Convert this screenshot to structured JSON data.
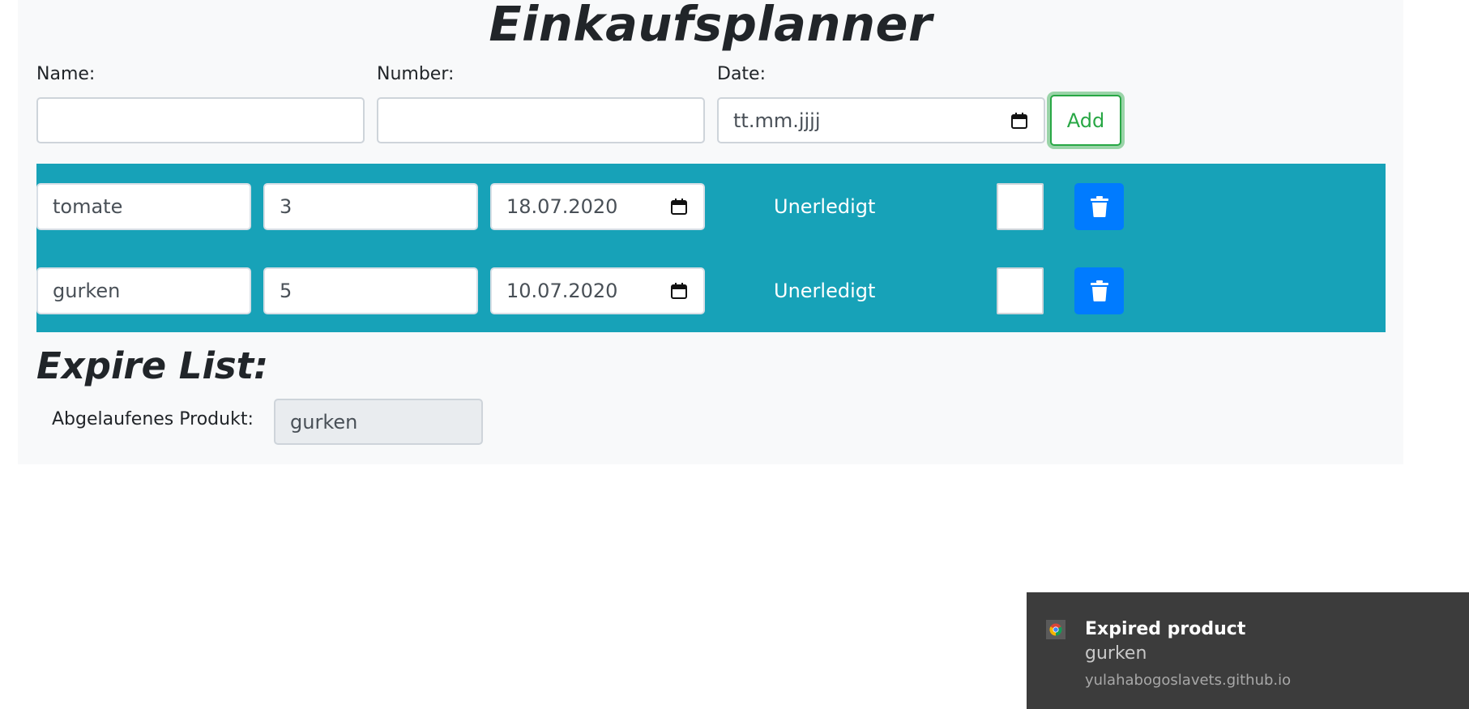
{
  "app": {
    "title": "Einkaufsplanner"
  },
  "form": {
    "name_label": "Name:",
    "number_label": "Number:",
    "date_label": "Date:",
    "name_value": "",
    "number_value": "",
    "date_placeholder": "tt.mm.jjjj",
    "add_label": "Add"
  },
  "items": [
    {
      "name": "tomate",
      "number": "3",
      "date": "18.07.2020",
      "status": "Unerledigt",
      "done": false
    },
    {
      "name": "gurken",
      "number": "5",
      "date": "10.07.2020",
      "status": "Unerledigt",
      "done": false
    }
  ],
  "expire": {
    "title": "Expire List:",
    "label": "Abgelaufenes Produkt:",
    "value": "gurken"
  },
  "notification": {
    "title": "Expired product",
    "body": "gurken",
    "source": "yulahabogoslavets.github.io",
    "icon": "chrome-icon"
  },
  "colors": {
    "list_bg": "#17a2b8",
    "add_green": "#28a745",
    "delete_blue": "#007bff",
    "panel_bg": "#f8f9fa",
    "toast_bg": "#3c3c3c"
  },
  "icons": {
    "calendar": "calendar-icon",
    "delete": "trash-icon"
  }
}
